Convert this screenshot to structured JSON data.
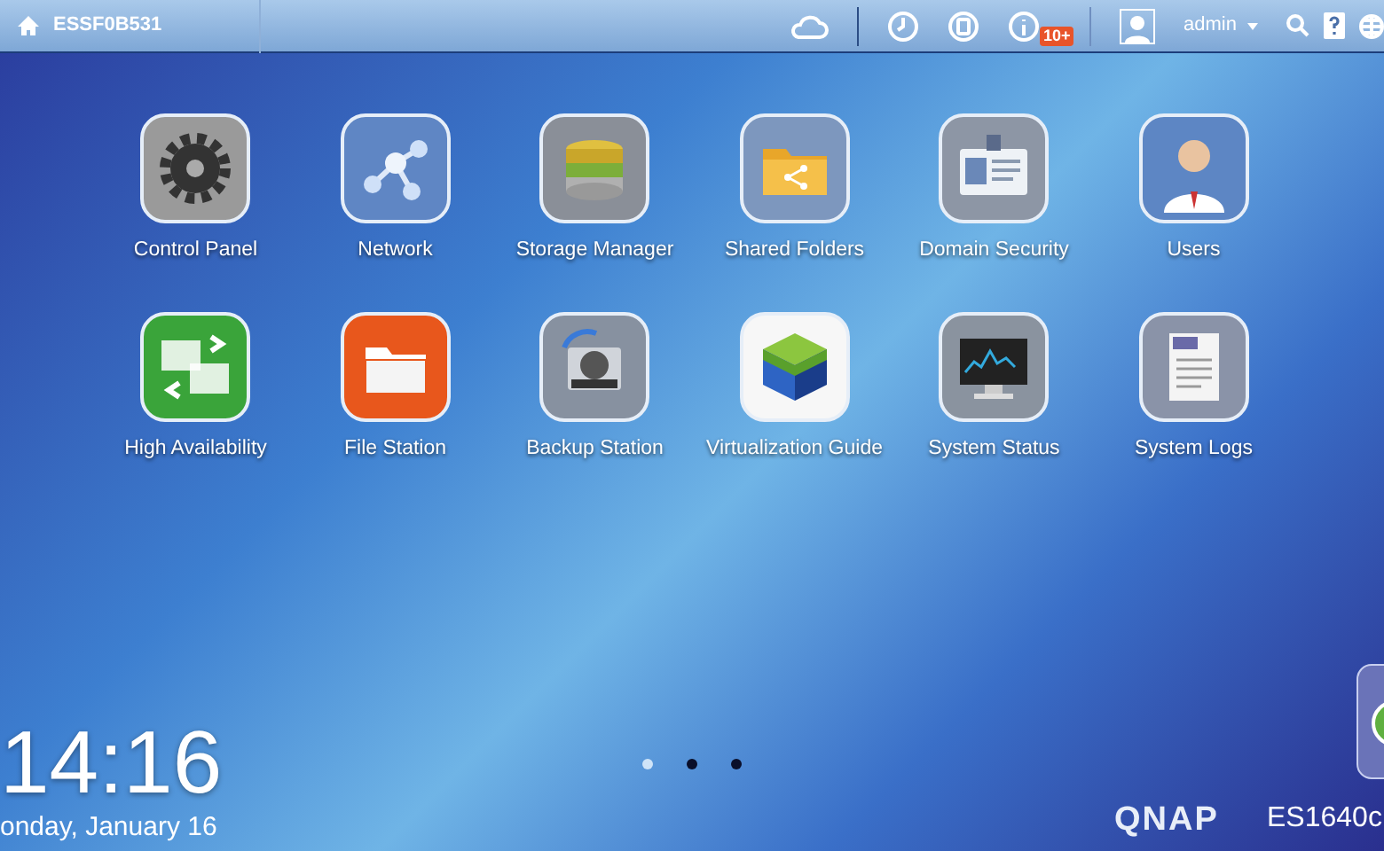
{
  "top_bar": {
    "hostname": "ESSF0B531",
    "notification_badge": "10+",
    "user": "admin"
  },
  "apps": [
    {
      "label": "Control Panel",
      "kind": "gear"
    },
    {
      "label": "Network",
      "kind": "network"
    },
    {
      "label": "Storage Manager",
      "kind": "storage"
    },
    {
      "label": "Shared Folders",
      "kind": "share"
    },
    {
      "label": "Domain Security",
      "kind": "idcard"
    },
    {
      "label": "Users",
      "kind": "person"
    },
    {
      "label": "High Availability",
      "kind": "ha"
    },
    {
      "label": "File Station",
      "kind": "folder"
    },
    {
      "label": "Backup Station",
      "kind": "backup"
    },
    {
      "label": "Virtualization Guide",
      "kind": "cube"
    },
    {
      "label": "System Status",
      "kind": "monitor"
    },
    {
      "label": "System Logs",
      "kind": "log"
    }
  ],
  "clock": {
    "time": "14:16",
    "date": "onday, January 16"
  },
  "pages": [
    {
      "selected": true
    },
    {
      "selected": false
    },
    {
      "selected": false
    }
  ],
  "brand": {
    "logo": "QNAP",
    "model": "ES1640c"
  }
}
